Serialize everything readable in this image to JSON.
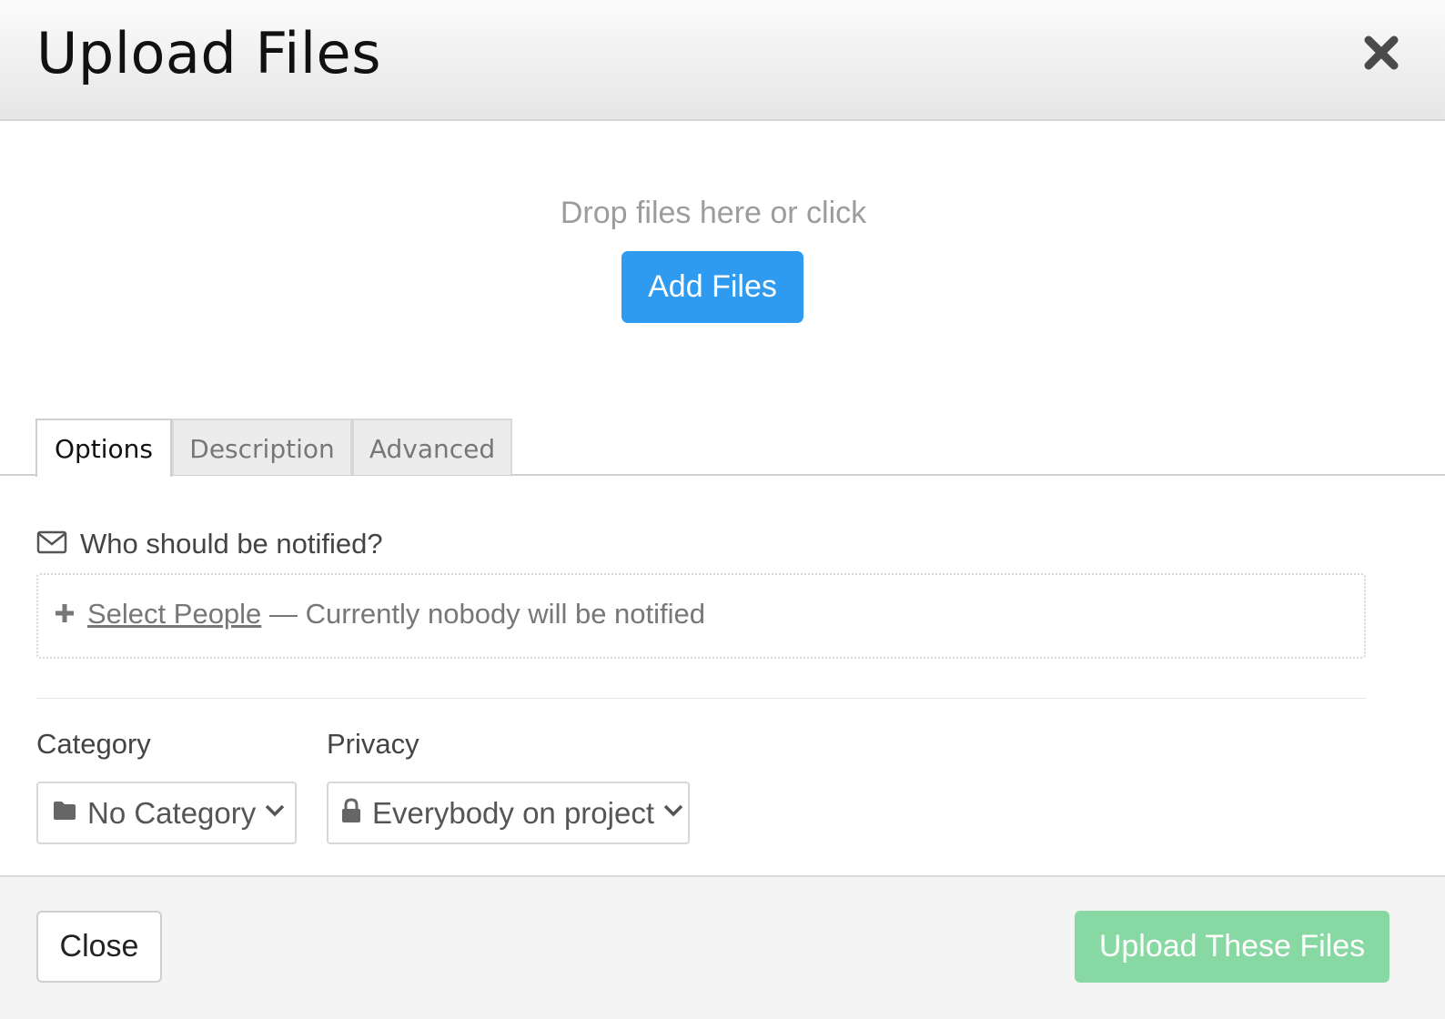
{
  "header": {
    "title": "Upload Files",
    "close_icon": "close-x-icon"
  },
  "dropzone": {
    "text": "Drop files here or click",
    "add_files_label": "Add Files",
    "accent_color": "#2e9bf0"
  },
  "tabs": [
    {
      "label": "Options",
      "active": true
    },
    {
      "label": "Description",
      "active": false
    },
    {
      "label": "Advanced",
      "active": false
    }
  ],
  "notify": {
    "icon": "envelope-icon",
    "heading": "Who should be notified?",
    "select_people_label": "Select People",
    "status": "— Currently nobody will be notified"
  },
  "category": {
    "label": "Category",
    "icon": "folder-icon",
    "value": "No Category"
  },
  "privacy": {
    "label": "Privacy",
    "icon": "lock-icon",
    "value": "Everybody on project"
  },
  "footer": {
    "close_label": "Close",
    "upload_label": "Upload These Files",
    "upload_color": "#88d8a3"
  }
}
